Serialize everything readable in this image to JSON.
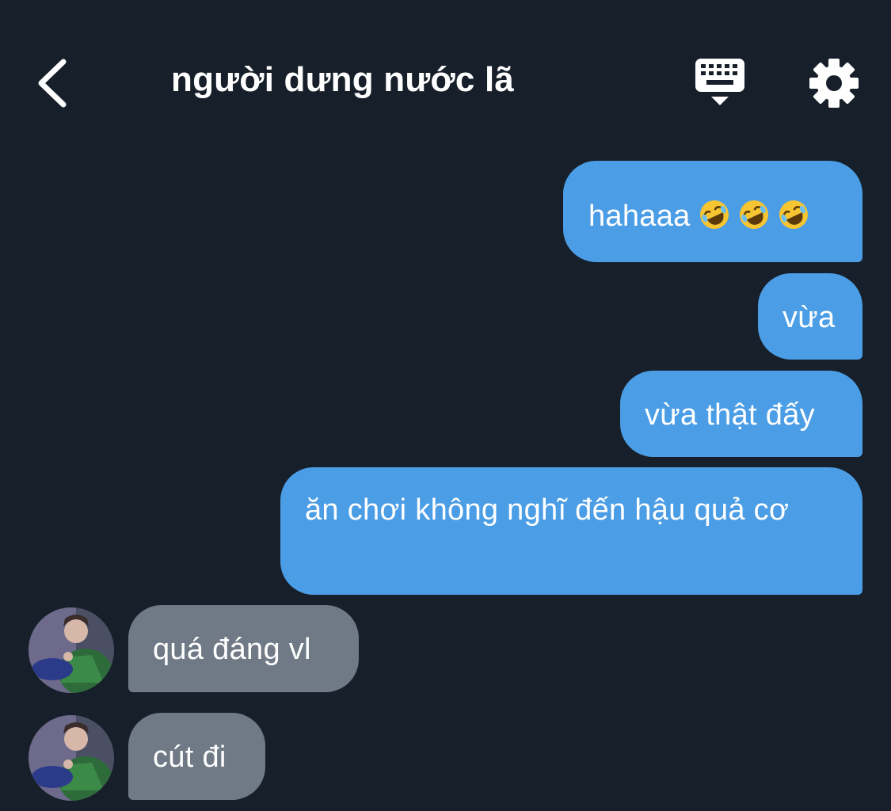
{
  "header": {
    "title": "người dưng nước lã",
    "back_icon": "chevron-left-icon",
    "keyboard_icon": "keyboard-icon",
    "settings_icon": "gear-icon"
  },
  "messages": [
    {
      "side": "sent",
      "text": "hahaaa",
      "emoji": [
        "rolling-on-floor-laughing",
        "rolling-on-floor-laughing",
        "rolling-on-floor-laughing"
      ]
    },
    {
      "side": "sent",
      "text": "vừa"
    },
    {
      "side": "sent",
      "text": "vừa thật đấy"
    },
    {
      "side": "sent",
      "text": "ăn chơi không nghĩ đến hậu quả cơ"
    },
    {
      "side": "received",
      "text": "quá đáng vl"
    },
    {
      "side": "received",
      "text": "cút đi"
    }
  ],
  "colors": {
    "background": "#17202a",
    "sent_bubble": "#4b9de6",
    "received_bubble": "#6f7a86",
    "text": "#ffffff"
  }
}
